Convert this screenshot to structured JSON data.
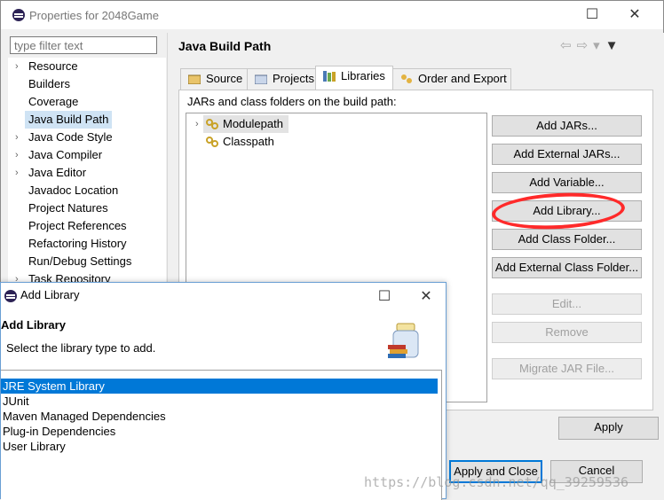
{
  "window": {
    "title": "Properties for 2048Game"
  },
  "nav": {
    "filter_placeholder": "type filter text",
    "items": [
      {
        "label": "Resource",
        "expandable": true
      },
      {
        "label": "Builders",
        "expandable": false
      },
      {
        "label": "Coverage",
        "expandable": false
      },
      {
        "label": "Java Build Path",
        "expandable": false,
        "selected": true
      },
      {
        "label": "Java Code Style",
        "expandable": true
      },
      {
        "label": "Java Compiler",
        "expandable": true
      },
      {
        "label": "Java Editor",
        "expandable": true
      },
      {
        "label": "Javadoc Location",
        "expandable": false
      },
      {
        "label": "Project Natures",
        "expandable": false
      },
      {
        "label": "Project References",
        "expandable": false
      },
      {
        "label": "Refactoring History",
        "expandable": false
      },
      {
        "label": "Run/Debug Settings",
        "expandable": false
      },
      {
        "label": "Task Repository",
        "expandable": true
      }
    ]
  },
  "page": {
    "title": "Java Build Path",
    "tabs": [
      "Source",
      "Projects",
      "Libraries",
      "Order and Export"
    ],
    "active_tab": "Libraries",
    "jars_label": "JARs and class folders on the build path:",
    "tree": [
      "Modulepath",
      "Classpath"
    ],
    "buttons": [
      "Add JARs...",
      "Add External JARs...",
      "Add Variable...",
      "Add Library...",
      "Add Class Folder...",
      "Add External Class Folder...",
      "Edit...",
      "Remove",
      "Migrate JAR File..."
    ],
    "apply": "Apply"
  },
  "footer": {
    "apply_and_close": "Apply and Close",
    "cancel": "Cancel"
  },
  "dialog": {
    "title": "Add Library",
    "heading": "Add Library",
    "subtitle": "Select the library type to add.",
    "items": [
      "JRE System Library",
      "JUnit",
      "Maven Managed Dependencies",
      "Plug-in Dependencies",
      "User Library"
    ],
    "selected": "JRE System Library"
  },
  "watermark": "https://blog.csdn.net/qq_39259536",
  "colors": {
    "selection": "#0078d7",
    "annotation": "#ff2a2a"
  }
}
